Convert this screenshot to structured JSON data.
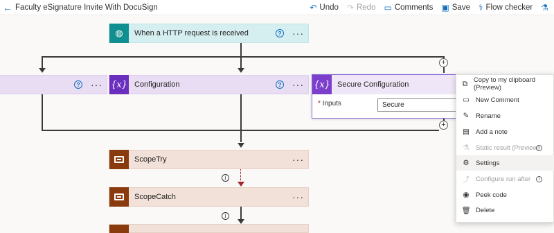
{
  "app": {
    "title": "Faculty eSignature Invite With DocuSign"
  },
  "toolbar": {
    "undo": "Undo",
    "redo": "Redo",
    "comments": "Comments",
    "save": "Save",
    "flow_checker": "Flow checker"
  },
  "flow": {
    "trigger": "When a HTTP request is received",
    "configuration": "Configuration",
    "secure_configuration": {
      "title": "Secure Configuration",
      "inputs_label": "Inputs",
      "inputs_value": "Secure"
    },
    "scope_try": "ScopeTry",
    "scope_catch": "ScopeCatch"
  },
  "context_menu": {
    "items": [
      {
        "label": "Copy to my clipboard (Preview)",
        "icon": "copy-icon",
        "disabled": false
      },
      {
        "label": "New Comment",
        "icon": "comment-icon",
        "disabled": false
      },
      {
        "label": "Rename",
        "icon": "pencil-icon",
        "disabled": false
      },
      {
        "label": "Add a note",
        "icon": "note-icon",
        "disabled": false
      },
      {
        "label": "Static result (Preview)",
        "icon": "flask-icon",
        "disabled": true
      },
      {
        "label": "Settings",
        "icon": "gear-icon",
        "disabled": false
      },
      {
        "label": "Configure run after",
        "icon": "run-after-icon",
        "disabled": true
      },
      {
        "label": "Peek code",
        "icon": "eye-icon",
        "disabled": false
      },
      {
        "label": "Delete",
        "icon": "trash-icon",
        "disabled": false
      }
    ]
  },
  "colors": {
    "http_icon": "#0f8f8f",
    "variable_icon": "#6b2fbf",
    "scope_icon": "#8a3b0d",
    "accent": "#0f6cbd"
  }
}
